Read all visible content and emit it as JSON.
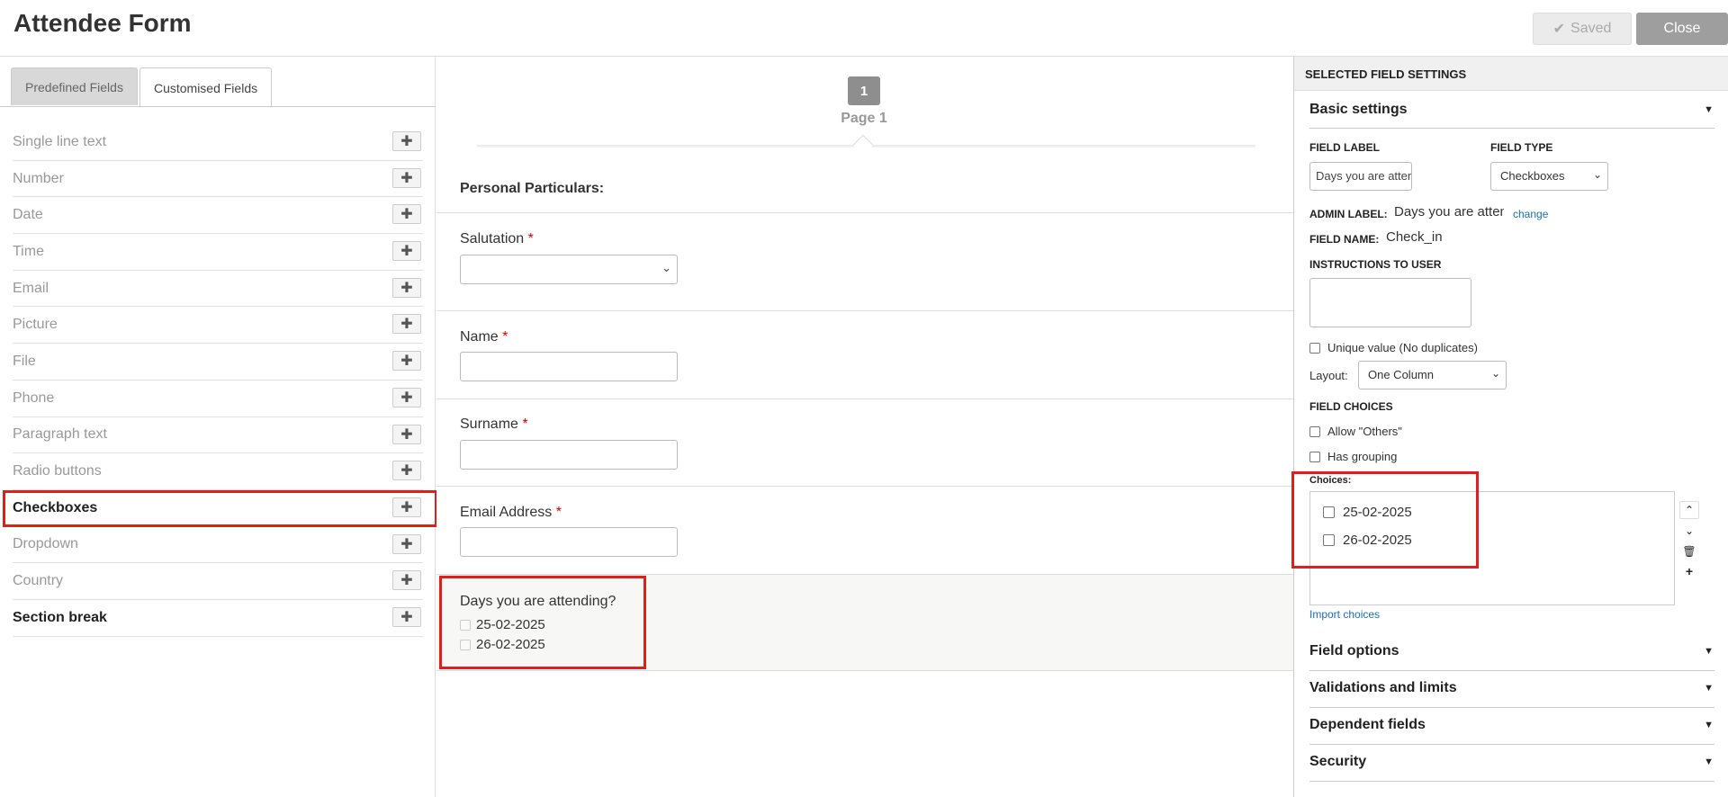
{
  "header": {
    "title": "Attendee Form",
    "saved_label": "Saved",
    "close_label": "Close"
  },
  "left_panel": {
    "tabs": [
      {
        "label": "Predefined Fields",
        "active": false
      },
      {
        "label": "Customised Fields",
        "active": true
      }
    ],
    "fields": [
      {
        "label": "Single line text",
        "bold": false
      },
      {
        "label": "Number",
        "bold": false
      },
      {
        "label": "Date",
        "bold": false
      },
      {
        "label": "Time",
        "bold": false
      },
      {
        "label": "Email",
        "bold": false
      },
      {
        "label": "Picture",
        "bold": false
      },
      {
        "label": "File",
        "bold": false
      },
      {
        "label": "Phone",
        "bold": false
      },
      {
        "label": "Paragraph text",
        "bold": false
      },
      {
        "label": "Radio buttons",
        "bold": false
      },
      {
        "label": "Checkboxes",
        "bold": true
      },
      {
        "label": "Dropdown",
        "bold": false
      },
      {
        "label": "Country",
        "bold": false
      },
      {
        "label": "Section break",
        "bold": true
      }
    ],
    "add_icon": "plus-icon"
  },
  "form": {
    "page_number": "1",
    "page_label": "Page 1",
    "section_title": "Personal Particulars:",
    "required_mark": "*",
    "fields": {
      "salutation": "Salutation",
      "name": "Name",
      "surname": "Surname",
      "email": "Email Address"
    },
    "checkbox_field": {
      "label": "Days you are attending?",
      "options": [
        "25-02-2025",
        "26-02-2025"
      ]
    }
  },
  "settings": {
    "header": "SELECTED FIELD SETTINGS",
    "basic_settings": "Basic settings",
    "field_label_title": "FIELD LABEL",
    "field_label_value": "Days you are attending?",
    "field_type_title": "FIELD TYPE",
    "field_type_value": "Checkboxes",
    "admin_label_title": "ADMIN LABEL:",
    "admin_label_value": "Days you are attending?",
    "admin_label_link": "change",
    "field_name_title": "FIELD NAME:",
    "field_name_value": "Check_in",
    "instructions_title": "INSTRUCTIONS TO USER",
    "unique_label": "Unique value (No duplicates)",
    "layout_label": "Layout:",
    "layout_value": "One Column",
    "field_choices_title": "FIELD CHOICES",
    "allow_others_label": "Allow \"Others\"",
    "has_grouping_label": "Has grouping",
    "choices_title": "Choices:",
    "choices": [
      "25-02-2025",
      "26-02-2025"
    ],
    "import_choices": "Import choices",
    "sections": [
      "Field options",
      "Validations and limits",
      "Dependent fields",
      "Security"
    ]
  },
  "colors": {
    "highlight": "#e01e1e",
    "link": "#1a6fb5",
    "close_button": "#9e9e9e"
  }
}
